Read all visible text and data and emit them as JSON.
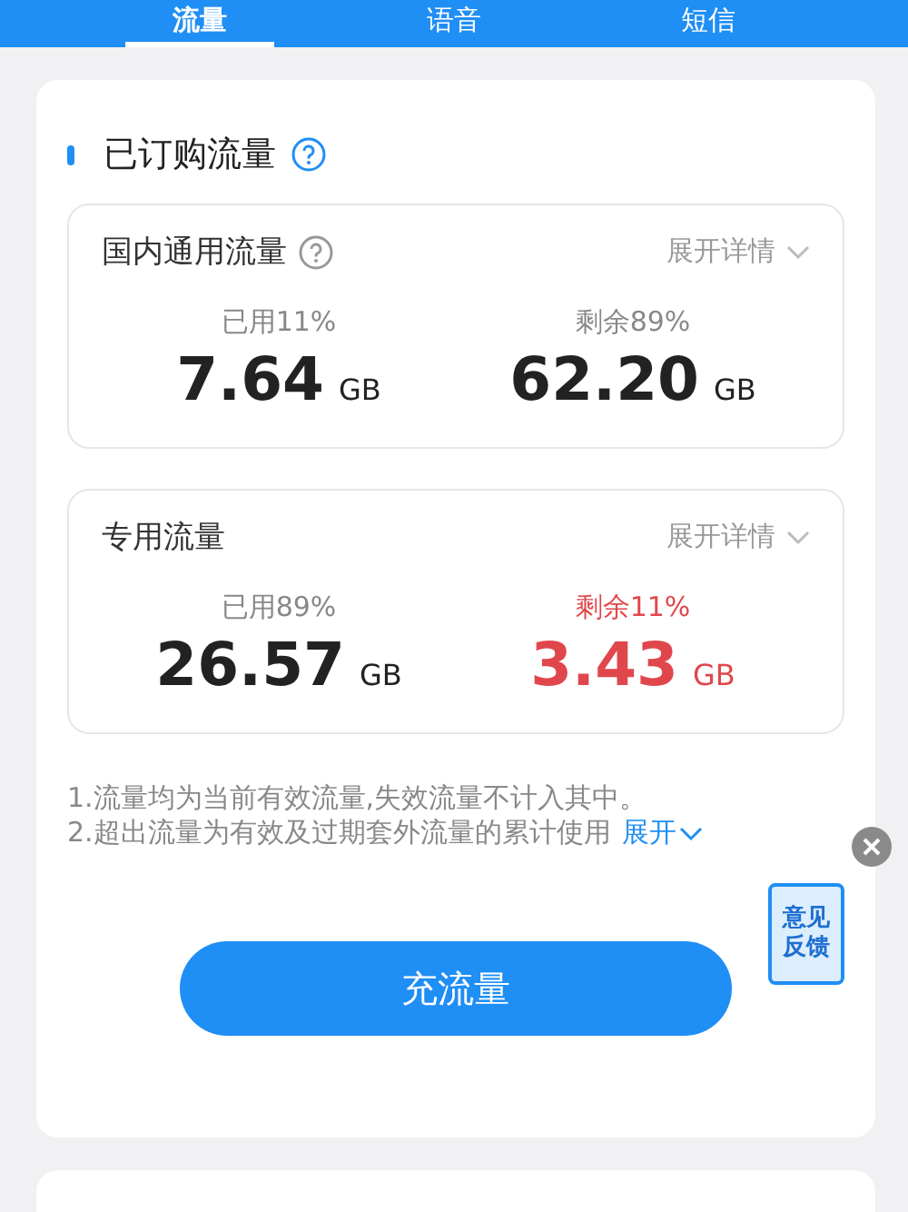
{
  "tabs": [
    {
      "label": "流量",
      "selected": true
    },
    {
      "label": "语音",
      "selected": false
    },
    {
      "label": "短信",
      "selected": false
    }
  ],
  "section": {
    "title": "已订购流量",
    "help": true
  },
  "packages": [
    {
      "name": "国内通用流量",
      "help": true,
      "details": "展开详情",
      "stats": [
        {
          "label": "已用11%",
          "value": "7.64",
          "unit": "GB",
          "warning": false
        },
        {
          "label": "剩余89%",
          "value": "62.20",
          "unit": "GB",
          "warning": false
        }
      ]
    },
    {
      "name": "专用流量",
      "help": false,
      "details": "展开详情",
      "stats": [
        {
          "label": "已用89%",
          "value": "26.57",
          "unit": "GB",
          "warning": false
        },
        {
          "label": "剩余11%",
          "value": "3.43",
          "unit": "GB",
          "warning": true
        }
      ]
    }
  ],
  "notes": [
    "1.流量均为当前有效流量,失效流量不计入其中。",
    "2.超出流量为有效及过期套外流量的累计使用"
  ],
  "expand": "展开",
  "button": "充流量",
  "feedback": {
    "label": "意见反馈"
  }
}
